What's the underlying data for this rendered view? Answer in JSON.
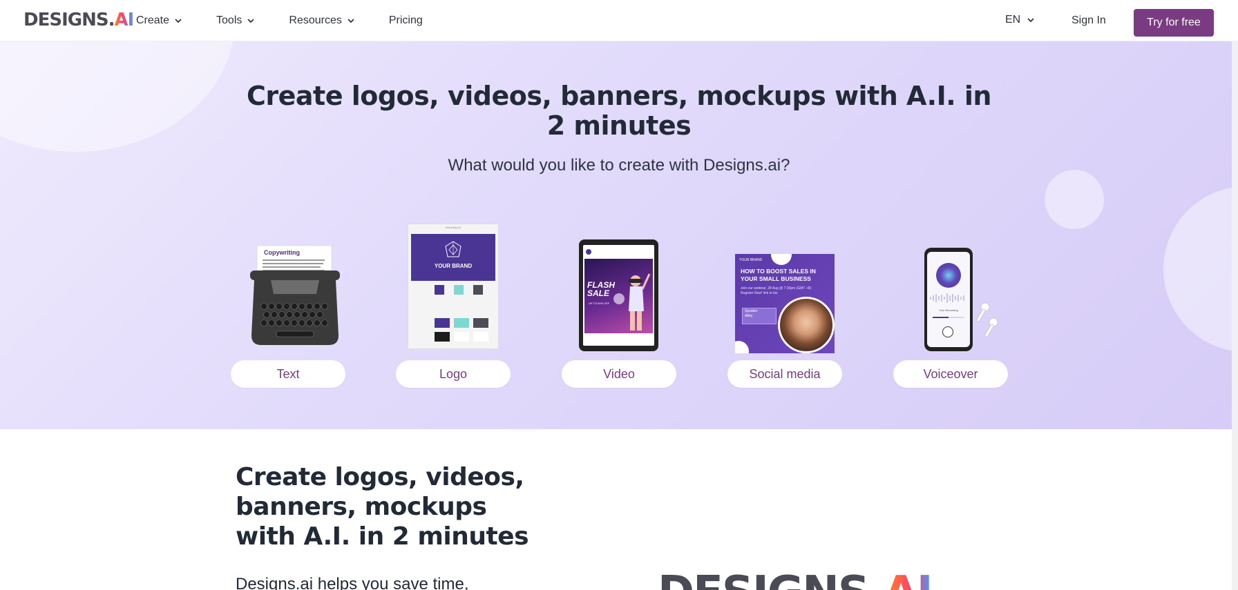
{
  "nav": {
    "logo_main": "DESIGNS.",
    "logo_ai": "AI",
    "menu": [
      {
        "label": "Create",
        "has_dropdown": true
      },
      {
        "label": "Tools",
        "has_dropdown": true
      },
      {
        "label": "Resources",
        "has_dropdown": true
      },
      {
        "label": "Pricing",
        "has_dropdown": false
      }
    ],
    "language": "EN",
    "sign_in": "Sign In",
    "cta": "Try for free"
  },
  "hero": {
    "title": "Create logos, videos, banners, mockups with A.I. in 2 minutes",
    "subtitle": "What would you like to create with Designs.ai?",
    "options": [
      {
        "label": "Text",
        "image": "typewriter",
        "image_text": "Copywriting"
      },
      {
        "label": "Logo",
        "image": "brand-guide",
        "image_text": "YOUR BRAND",
        "image_header": "Branding Kit"
      },
      {
        "label": "Video",
        "image": "tablet",
        "image_text": "FLASH SALE",
        "image_subtext": "UP TO 50% OFF"
      },
      {
        "label": "Social media",
        "image": "social-post",
        "image_text": "HOW TO BOOST SALES IN YOUR SMALL BUSINESS",
        "image_subtext": "Join our webinar, 28 Aug @ 7:30pm (GMT +8) Register Now! link in bio",
        "image_tag": "YOUR BRAND",
        "image_speaker": "Speaker",
        "image_name": "Abby"
      },
      {
        "label": "Voiceover",
        "image": "phone",
        "image_text": "Your Recording"
      }
    ]
  },
  "section2": {
    "title": "Create logos, videos, banners, mockups with A.I. in 2 minutes",
    "text": "Designs.ai helps you save time,"
  },
  "brand_colors": {
    "primary": "#7a3b83",
    "hero_bg": "#e2dbfb",
    "heading": "#222a38"
  }
}
